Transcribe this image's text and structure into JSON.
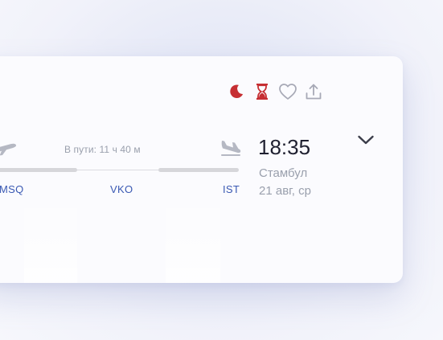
{
  "flight": {
    "duration_text": "В пути: 11 ч 40 м",
    "codes": {
      "origin": "MSQ",
      "transfer": "VKO",
      "destination": "IST"
    },
    "arrival": {
      "time": "18:35",
      "city": "Стамбул",
      "date": "21 авг, ср"
    }
  },
  "icons": {
    "night": "moon-icon",
    "waiting": "hourglass-icon",
    "favorite": "heart-icon",
    "share": "share-icon",
    "departure_plane": "airplane-departure-icon",
    "arrival_plane": "airplane-arrival-icon",
    "expand": "chevron-down-icon"
  },
  "colors": {
    "accent_red": "#c62f33",
    "code_blue": "#3a59b3",
    "muted_text": "#9aa0ad",
    "icon_gray": "#a7a9b6"
  }
}
